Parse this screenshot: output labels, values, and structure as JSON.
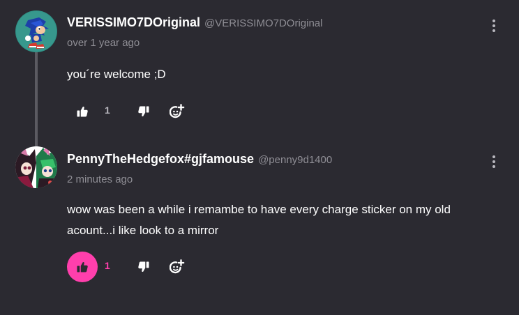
{
  "colors": {
    "background": "#2b2a31",
    "accent": "#ff3fac",
    "muted": "#8f8e95",
    "icon": "#ffffff",
    "thread_line": "#5b5a61"
  },
  "comments": [
    {
      "display_name": "VERISSIMO7DOriginal",
      "username": "@VERISSIMO7DOriginal",
      "time": "over 1 year ago",
      "body": "you´re welcome ;D",
      "like_count": "1",
      "liked": false,
      "avatar_icon": "sonic-avatar-icon"
    },
    {
      "display_name": "PennyTheHedgefox#gjfamouse",
      "username": "@penny9d1400",
      "time": "2 minutes ago",
      "body": "wow was been a while i remambe to have every charge sticker on my old acount...i like look to a mirror",
      "like_count": "1",
      "liked": true,
      "avatar_icon": "hedgefox-avatar-icon"
    }
  ],
  "icons": {
    "like": "thumbs-up-icon",
    "dislike": "thumbs-down-icon",
    "sticker": "add-sticker-icon",
    "more": "more-vertical-icon"
  }
}
